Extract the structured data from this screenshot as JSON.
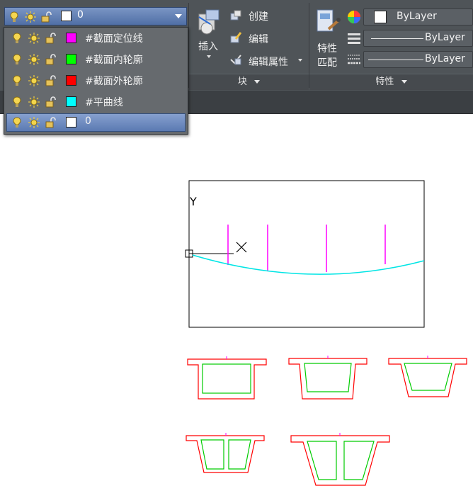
{
  "layer_dropdown": {
    "current_layer": "0",
    "current_color": "#ffffff",
    "layers": [
      {
        "name": "#截面定位线",
        "color": "#ff00ff",
        "selected": false
      },
      {
        "name": "#截面内轮廓",
        "color": "#00ff00",
        "selected": false
      },
      {
        "name": "#截面外轮廓",
        "color": "#ff0000",
        "selected": false
      },
      {
        "name": "#平曲线",
        "color": "#00ffff",
        "selected": false
      },
      {
        "name": "0",
        "color": "#ffffff",
        "selected": true
      }
    ]
  },
  "block_panel": {
    "insert_label": "插入",
    "create_label": "创建",
    "edit_label": "编辑",
    "edit_attributes_label": "编辑属性",
    "panel_title": "块"
  },
  "properties_panel": {
    "match_line1": "特性",
    "match_line2": "匹配",
    "color_value": "ByLayer",
    "linetype_value": "ByLayer",
    "lineweight_value": "ByLayer",
    "panel_title": "特性"
  },
  "drawing": {
    "ucs_y_label": "Y",
    "colors": {
      "frame": "#000000",
      "station_lines": "#ff00ff",
      "curve": "#00ffff",
      "outer_contour": "#ff0000",
      "inner_contour": "#00ff00"
    }
  }
}
